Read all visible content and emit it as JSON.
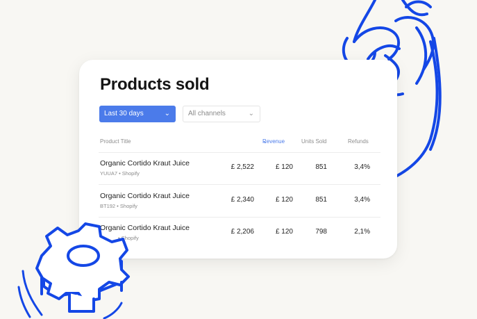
{
  "card": {
    "title": "Products sold",
    "period_filter": {
      "value": "Last 30 days"
    },
    "channel_filter": {
      "value": "All channels"
    },
    "columns": {
      "product_title": "Product Title",
      "revenue": "Revenue",
      "units_sold": "Units Sold",
      "refunds": "Refunds"
    },
    "rows": [
      {
        "name": "Organic Cortido Kraut Juice",
        "meta": "YUUA7 • Shopify",
        "price": "£ 2,522",
        "revenue": "£ 120",
        "units": "851",
        "refunds": "3,4%"
      },
      {
        "name": "Organic Cortido Kraut Juice",
        "meta": "BT192 • Shopify",
        "price": "£ 2,340",
        "revenue": "£ 120",
        "units": "851",
        "refunds": "3,4%"
      },
      {
        "name": "Organic Cortido Kraut Juice",
        "meta": "• Shopify",
        "price": "£ 2,206",
        "revenue": "£ 120",
        "units": "798",
        "refunds": "2,1%"
      }
    ]
  },
  "colors": {
    "accent": "#4b7bea",
    "doodle": "#1447e6",
    "background": "#f8f7f3"
  },
  "icons": {
    "dropdown": "chevron-down-icon",
    "sort": "sort-desc-icon"
  }
}
